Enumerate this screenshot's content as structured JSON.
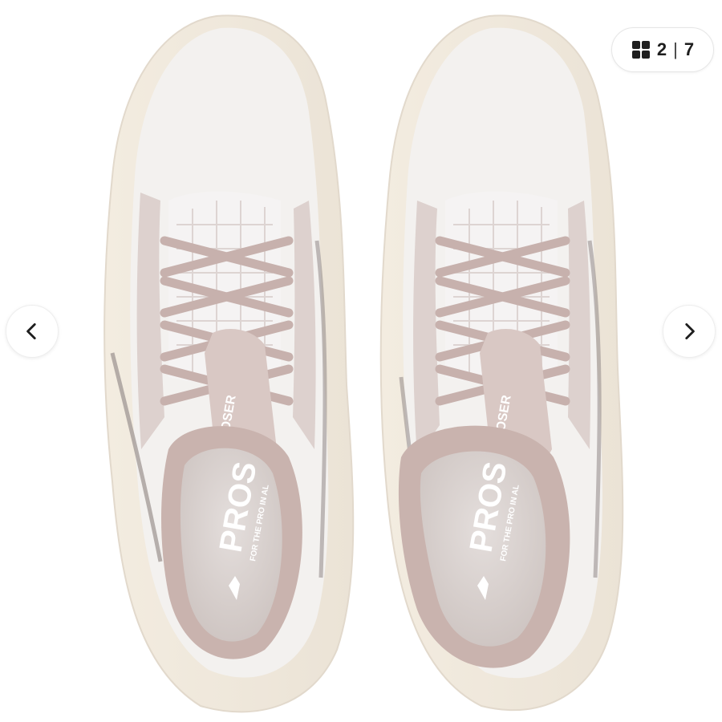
{
  "gallery": {
    "current_index": "2",
    "separator": "|",
    "total_count": "7",
    "grid_icon": "grid-icon",
    "prev_icon": "chevron-left-icon",
    "next_icon": "chevron-right-icon"
  },
  "product_image": {
    "insole_brand_text": "PROS",
    "tongue_brand_text": "PROSER",
    "insole_tagline": "FOR THE PRO IN AL",
    "colors": {
      "upper": "#efeceb",
      "overlay": "#d6c6c3",
      "lace": "#c7b1ad",
      "sole": "#efe8dc",
      "insole": "#dcd5d3"
    }
  }
}
